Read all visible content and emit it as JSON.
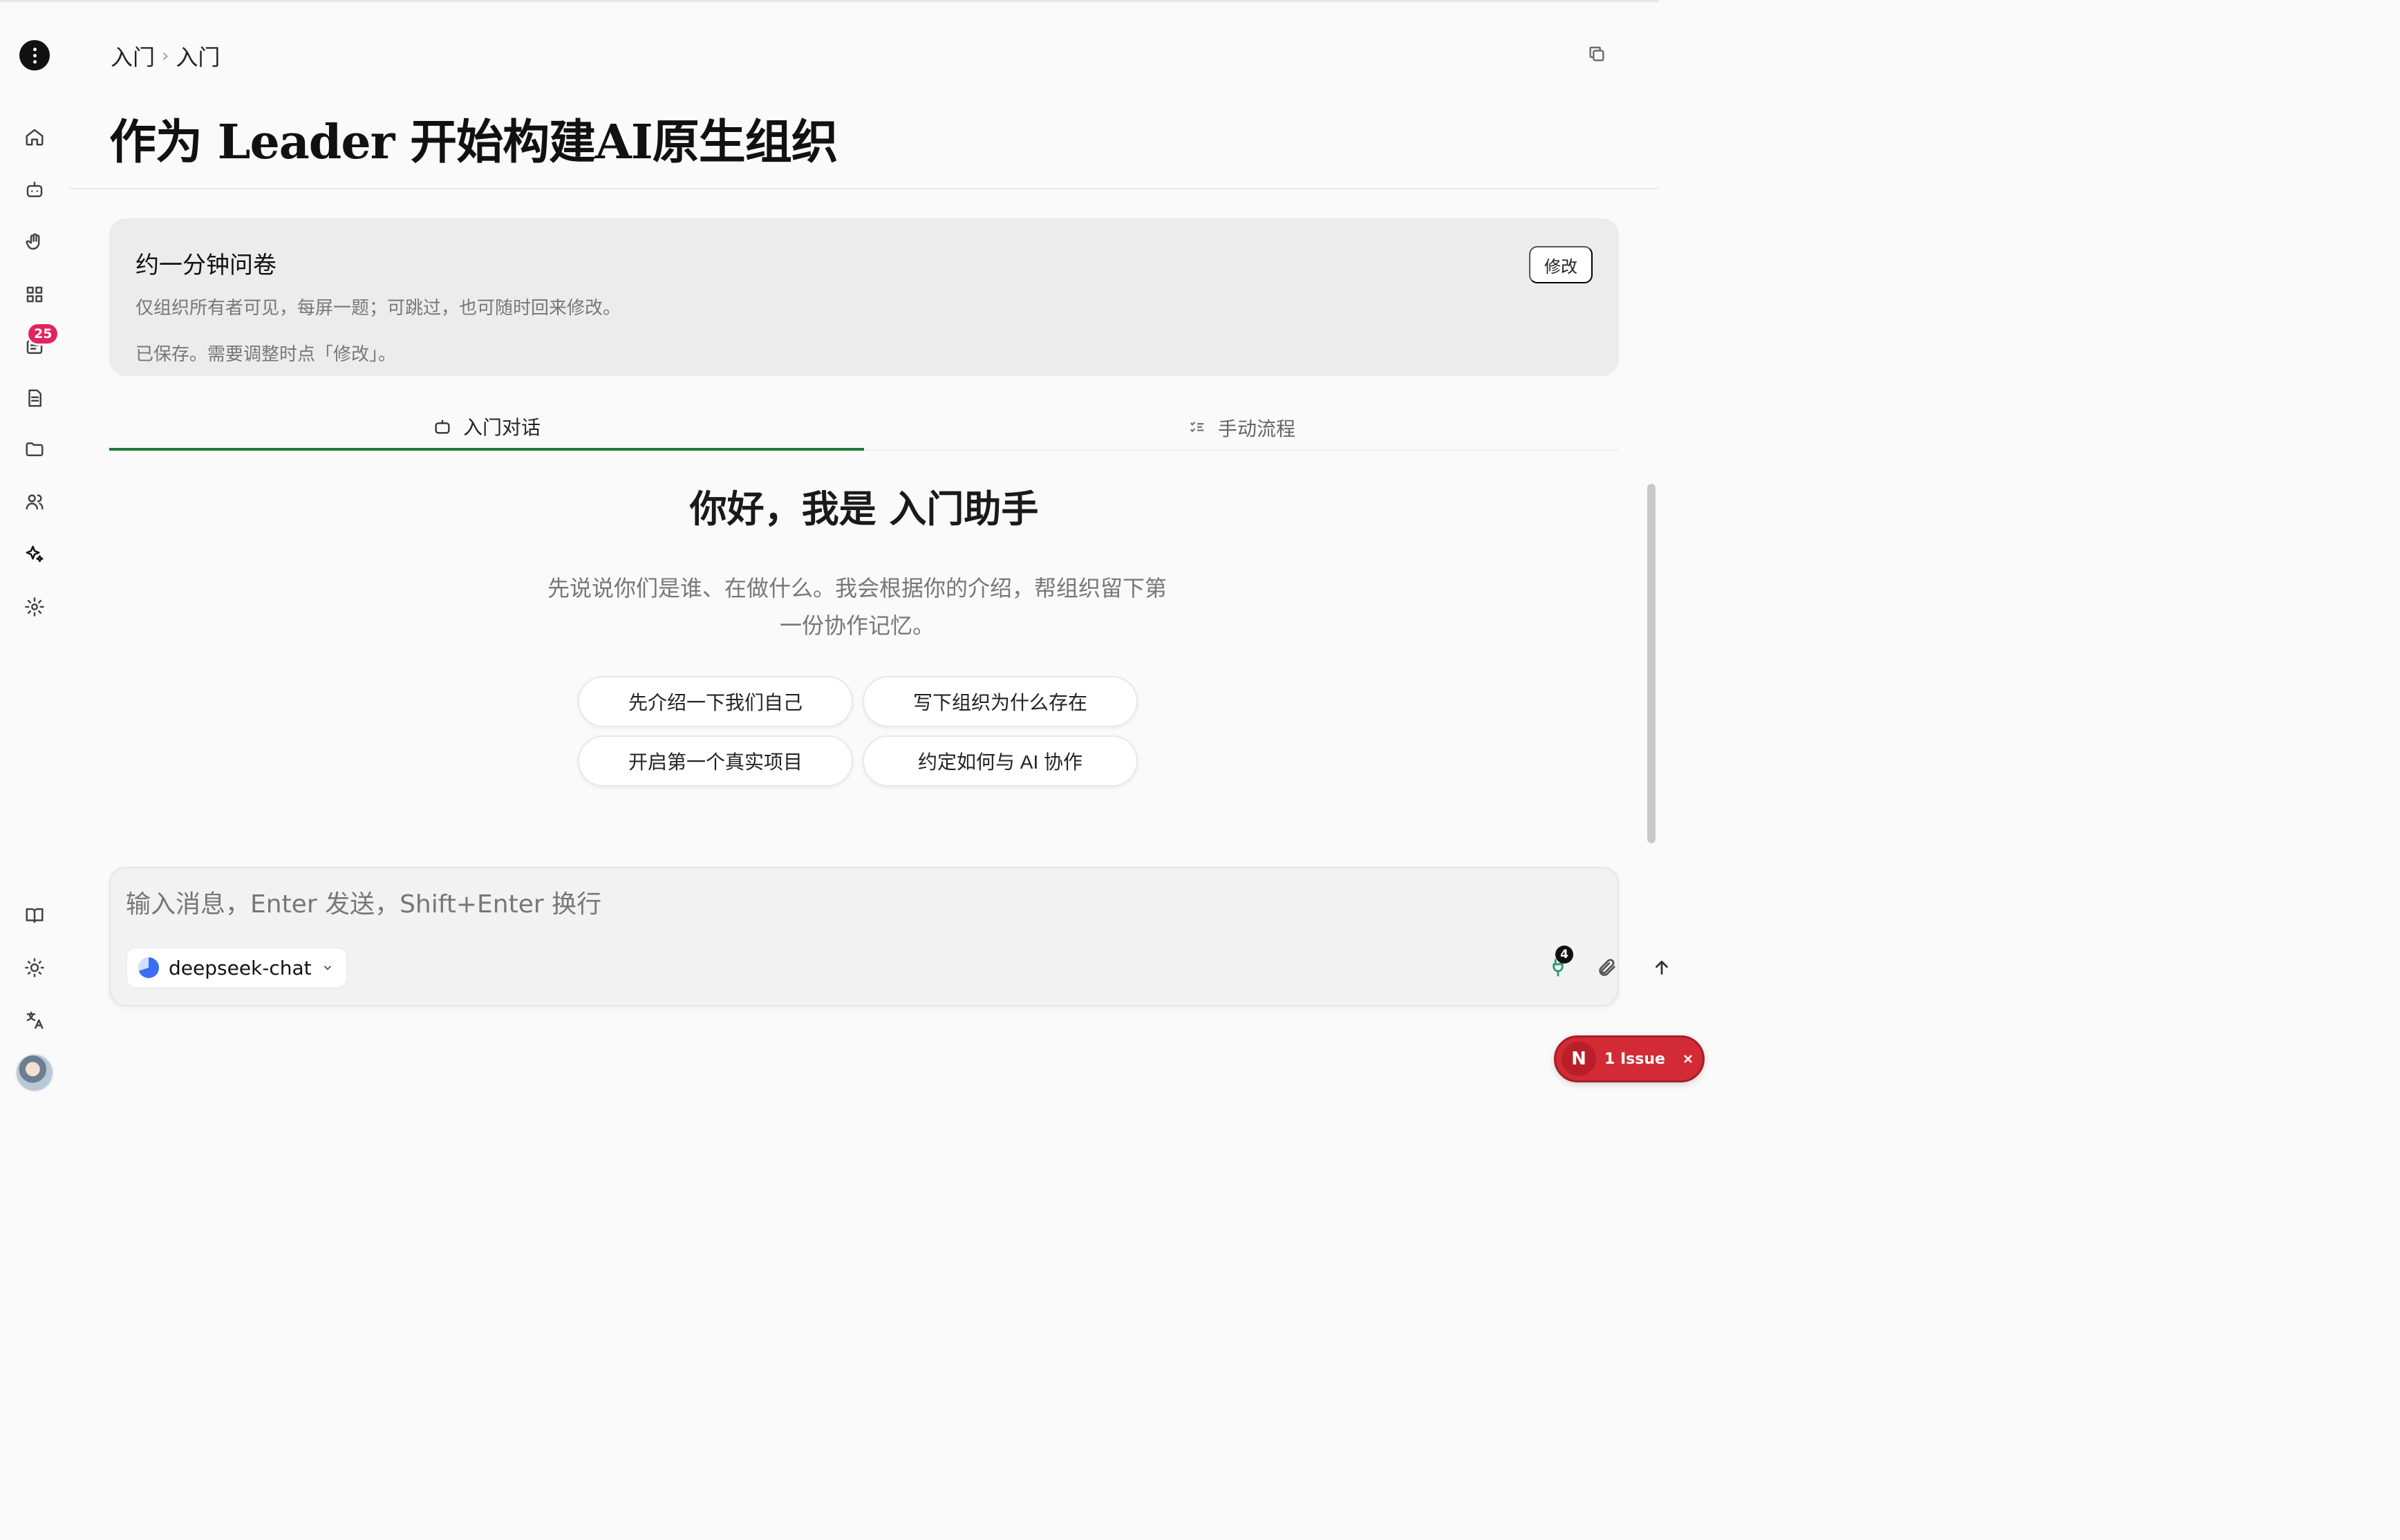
{
  "breadcrumb": [
    "入门",
    "入门"
  ],
  "page": {
    "title": "作为 Leader 开始构建AI原生组织"
  },
  "survey": {
    "title": "约一分钟问卷",
    "description": "仅组织所有者可见，每屏一题；可跳过，也可随时回来修改。",
    "status": "已保存。需要调整时点「修改」。",
    "edit_label": "修改"
  },
  "tabs": [
    {
      "label": "入门对话",
      "icon": "bot-icon",
      "active": true
    },
    {
      "label": "手动流程",
      "icon": "checklist-icon",
      "active": false
    }
  ],
  "greeting": {
    "title": "你好，我是 入门助手",
    "description": "先说说你们是谁、在做什么。我会根据你的介绍，帮组织留下第一份协作记忆。"
  },
  "suggestions": [
    "先介绍一下我们自己",
    "写下组织为什么存在",
    "开启第一个真实项目",
    "约定如何与 AI 协作"
  ],
  "composer": {
    "placeholder": "输入消息，Enter 发送，Shift+Enter 换行",
    "value": "",
    "model": "deepseek-chat",
    "plugin_count": "4"
  },
  "sidebar": {
    "badge_count": "25",
    "items": [
      "home-icon",
      "bot-icon",
      "hand-icon",
      "grid-icon",
      "inbox-icon",
      "document-icon",
      "folder-icon",
      "users-icon",
      "sparkle-icon",
      "settings-icon"
    ],
    "bottom_items": [
      "book-icon",
      "sun-icon",
      "translate-icon"
    ]
  },
  "issue_indicator": {
    "label": "1 Issue",
    "letter": "N"
  },
  "colors": {
    "accent": "#1f7a3a",
    "badge": "#e0245e",
    "issue": "#d22b35"
  }
}
